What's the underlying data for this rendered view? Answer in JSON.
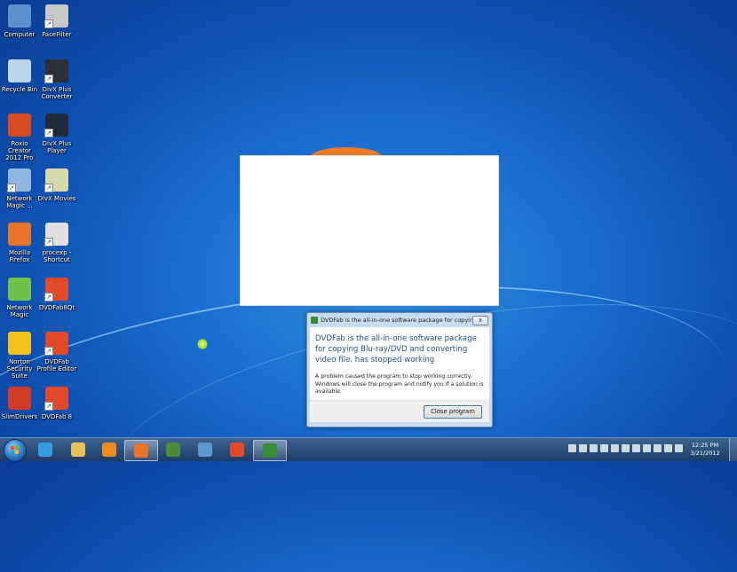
{
  "desktop": {
    "icons": [
      {
        "label": "Computer",
        "icon": "computer-icon",
        "color": "#5a8fd0"
      },
      {
        "label": "FaceFilter",
        "icon": "facefilter-icon",
        "color": "#c8c8c8"
      },
      {
        "label": "Recycle Bin",
        "icon": "recycle-bin-icon",
        "color": "#b9d6ea"
      },
      {
        "label": "DivX Plus Converter",
        "icon": "divx-converter-icon",
        "color": "#2a2f38"
      },
      {
        "label": "Roxio Creator 2012 Pro",
        "icon": "roxio-icon",
        "color": "#d84a1e"
      },
      {
        "label": "DivX Plus Player",
        "icon": "divx-player-icon",
        "color": "#1e2a3a"
      },
      {
        "label": "Network Magic ...",
        "icon": "network-magic-icon",
        "color": "#8fb8e0"
      },
      {
        "label": "DivX Movies",
        "icon": "divx-movies-icon",
        "color": "#d9d9b0"
      },
      {
        "label": "Mozilla Firefox",
        "icon": "firefox-icon",
        "color": "#e8742a"
      },
      {
        "label": "procexp - Shortcut",
        "icon": "procexp-icon",
        "color": "#e0e0e0"
      },
      {
        "label": "Network Magic",
        "icon": "network-magic-house-icon",
        "color": "#6cc24a"
      },
      {
        "label": "DVDFab8Qt",
        "icon": "dvdfab-icon",
        "color": "#e24a2a"
      },
      {
        "label": "Norton Security Suite",
        "icon": "norton-icon",
        "color": "#f2c21a"
      },
      {
        "label": "DVDFab Profile Editor",
        "icon": "dvdfab-profile-icon",
        "color": "#e24a2a"
      },
      {
        "label": "SlimDrivers",
        "icon": "slimdrivers-icon",
        "color": "#d23a2a"
      },
      {
        "label": "DVDFab 8",
        "icon": "dvdfab8-icon",
        "color": "#e24a2a"
      }
    ]
  },
  "dialog": {
    "title": "DVDFab is the all-in-one software package for copyin...",
    "close_glyph": "x",
    "main_message": "DVDFab is the all-in-one software package for copying Blu-ray/DVD and converting video file. has stopped working",
    "detail_message": "A problem caused the program to stop working correctly. Windows will close the program and notify you if a solution is available.",
    "close_program_label": "Close program"
  },
  "taskbar": {
    "pinned": [
      {
        "icon": "internet-explorer-icon",
        "color": "#3a9ae0"
      },
      {
        "icon": "windows-explorer-icon",
        "color": "#e8c15a"
      },
      {
        "icon": "media-player-icon",
        "color": "#f08a1e"
      },
      {
        "icon": "firefox-taskbar-icon",
        "color": "#e8742a",
        "active": true
      },
      {
        "icon": "network-taskbar-icon",
        "color": "#4a8a3a"
      },
      {
        "icon": "remote-desktop-taskbar-icon",
        "color": "#5a9ad0"
      },
      {
        "icon": "dvdfab-taskbar-icon",
        "color": "#e24a2a"
      },
      {
        "icon": "dvdfab-app-taskbar-icon",
        "color": "#3a8a3a",
        "active": true
      }
    ],
    "clock_time": "12:25 PM",
    "clock_date": "3/21/2012"
  }
}
